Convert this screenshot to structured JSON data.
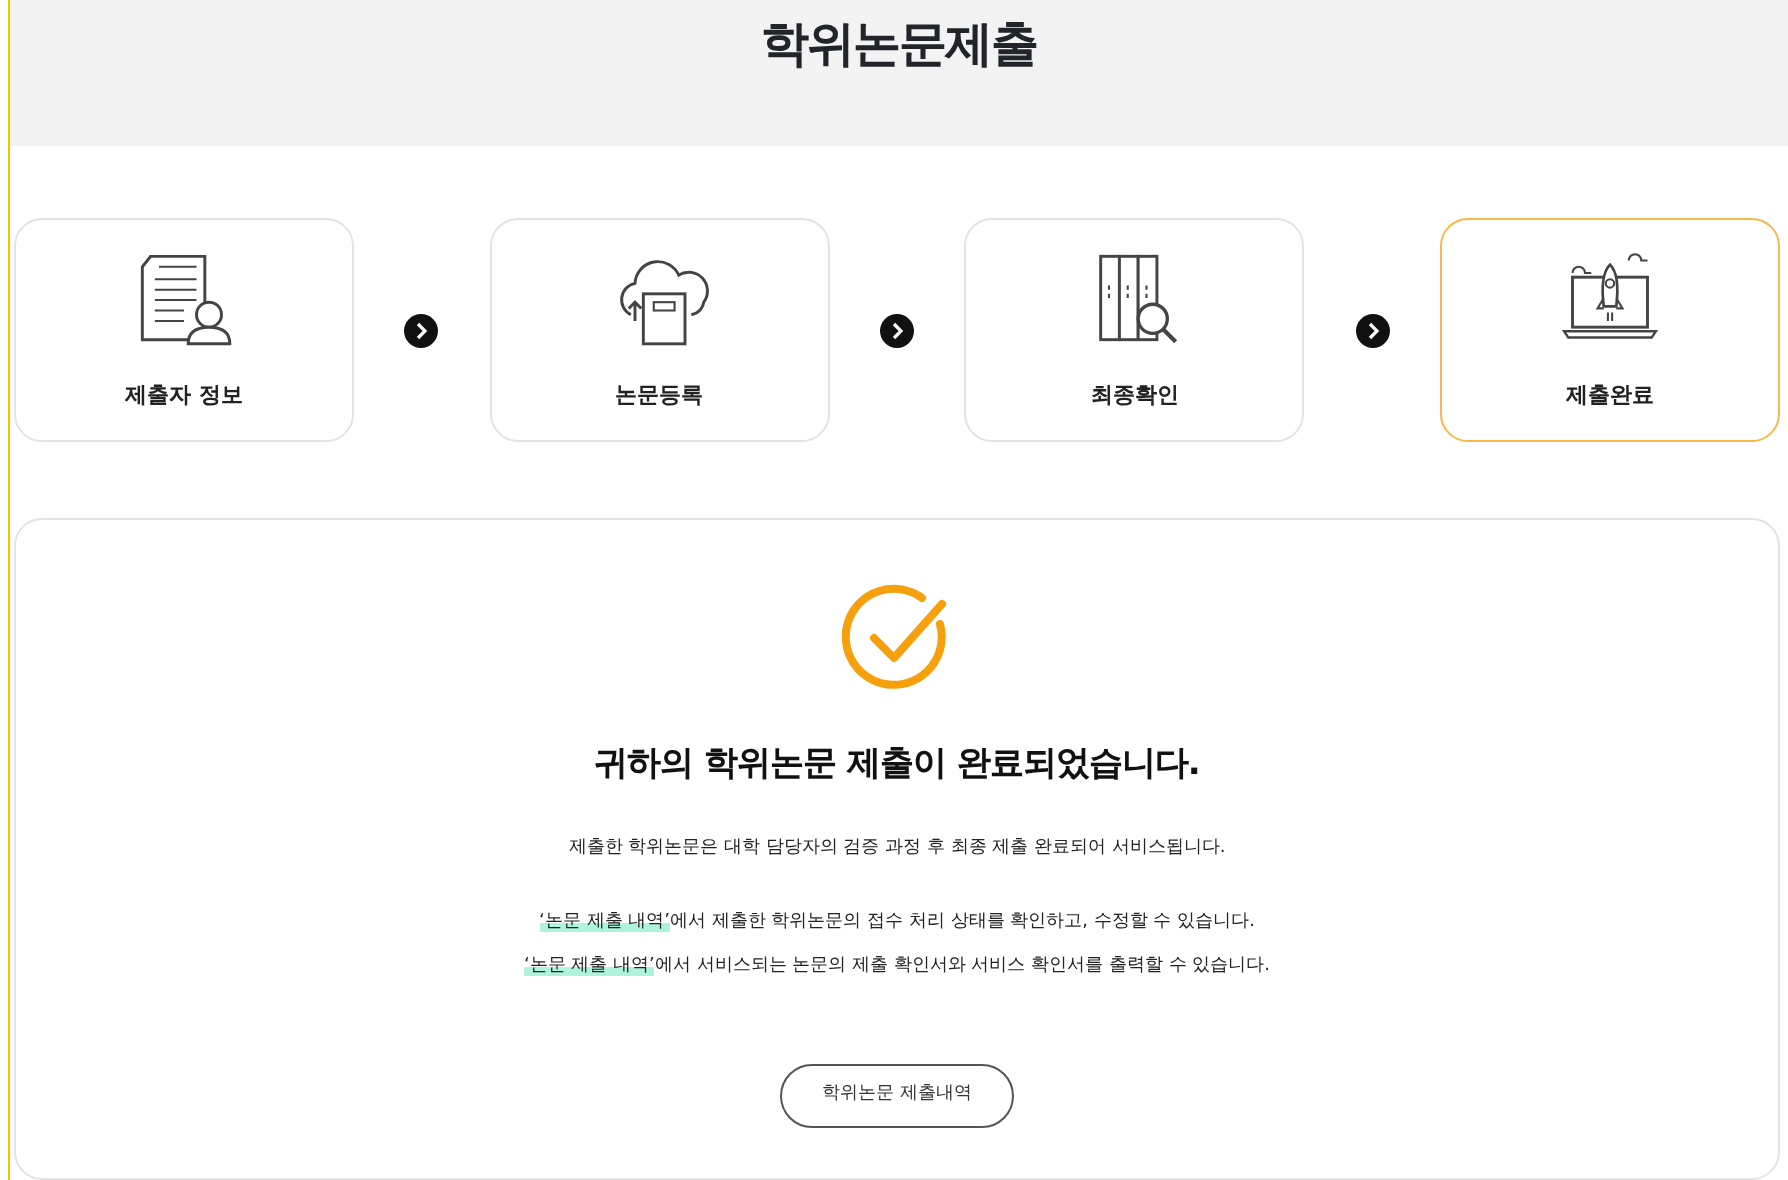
{
  "title": "학위논문제출",
  "steps": [
    {
      "label": "제출자 정보",
      "selected": false
    },
    {
      "label": "논문등록",
      "selected": false
    },
    {
      "label": "최종확인",
      "selected": false
    },
    {
      "label": "제출완료",
      "selected": true
    }
  ],
  "result": {
    "heading": "귀하의 학위논문 제출이 완료되었습니다.",
    "notice": "제출한 학위논문은 대학 담당자의 검증 과정 후 최종 제출 완료되어 서비스됩니다.",
    "lines": [
      {
        "highlight": "‘논문 제출 내역’",
        "text": "에서 제출한 학위논문의 접수 처리 상태를 확인하고, 수정할 수 있습니다."
      },
      {
        "highlight": "‘논문 제출 내역’",
        "text": "에서 서비스되는 논문의 제출 확인서와 서비스 확인서를 출력할 수 있습니다."
      }
    ],
    "button": "학위논문 제출내역"
  }
}
